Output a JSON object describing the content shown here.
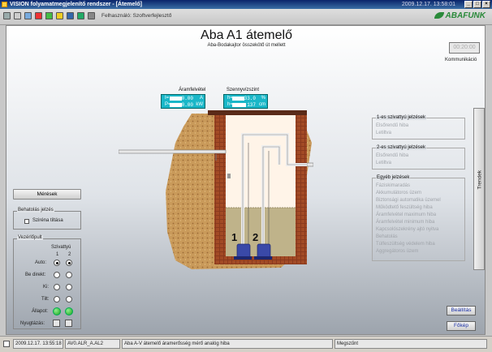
{
  "window": {
    "title": "VISION folyamatmegjelenítő rendszer - [Átemelő]",
    "clock": "2009.12.17. 13:58:01"
  },
  "toolbar": {
    "user_label": "Felhasználó: Szoftverfejlesztő",
    "logo": "ABAFUNK"
  },
  "page": {
    "title": "Aba A1 átemelő",
    "subtitle": "Aba-Bodakajtor összekötő út mellett"
  },
  "communication": {
    "value": "00:20:00",
    "label": "Kommunikáció"
  },
  "power": {
    "label": "Áramfelvétel",
    "rows": [
      {
        "sym": "I=",
        "value": "0.00",
        "unit": "A"
      },
      {
        "sym": "P=",
        "value": "0.00",
        "unit": "kW"
      }
    ]
  },
  "level": {
    "label": "Szennyvízszint",
    "rows": [
      {
        "sym": "h=",
        "value": "33.0",
        "unit": "%"
      },
      {
        "sym": "h=",
        "value": "137",
        "unit": "cm"
      }
    ]
  },
  "pumps": {
    "p1": "1",
    "p2": "2"
  },
  "left": {
    "meresek": "Mérések",
    "intrusion": {
      "title": "Behatolás jelzés",
      "siren": "Sziréna tiltása"
    },
    "control": {
      "title": "Vezérlőpult",
      "col_header": "Szivattyú",
      "col1": "1",
      "col2": "2",
      "rows": [
        "Auto:",
        "Be direkt:",
        "Ki:",
        "Tilt:"
      ],
      "state": "Állapot:",
      "ack": "Nyugtázás:"
    }
  },
  "right": {
    "pump1": {
      "title": "1-es szivattyú jelzések",
      "items": [
        "Elsőrendű hiba",
        "Letiltva"
      ]
    },
    "pump2": {
      "title": "2-es szivattyú jelzések",
      "items": [
        "Elsőrendű hiba",
        "Letiltva"
      ]
    },
    "other": {
      "title": "Egyéb jelzések",
      "items": [
        "Fázisk­imaradás",
        "Akkumulátoros üzem",
        "Biztonsági automatika üzemel",
        "Működtető feszültség hiba",
        "Áramfelvétel maximum hiba",
        "Áramfelvétel minimum hiba",
        "Kapcsolószekrény ajtó nyitva",
        "Behatolás",
        "Túlfeszültség védelem hiba",
        "Aggregátoros üzem"
      ]
    },
    "trendek": "Trendek",
    "beallitas": "Beállítás",
    "fokep": "Főkép"
  },
  "status": {
    "time": "2009.12.17. 13:55:18",
    "code": "AV0.ALR_A.AL2",
    "message": "Aba A-V átemelő áramerősség mérő analóg hiba",
    "state": "Megszűnt"
  },
  "colors": {
    "accent": "#1ab7c8",
    "soil": "#c8a060",
    "brick": "#8a3a1e",
    "water": "#b8ad88",
    "lamp": "#1aa31a"
  }
}
